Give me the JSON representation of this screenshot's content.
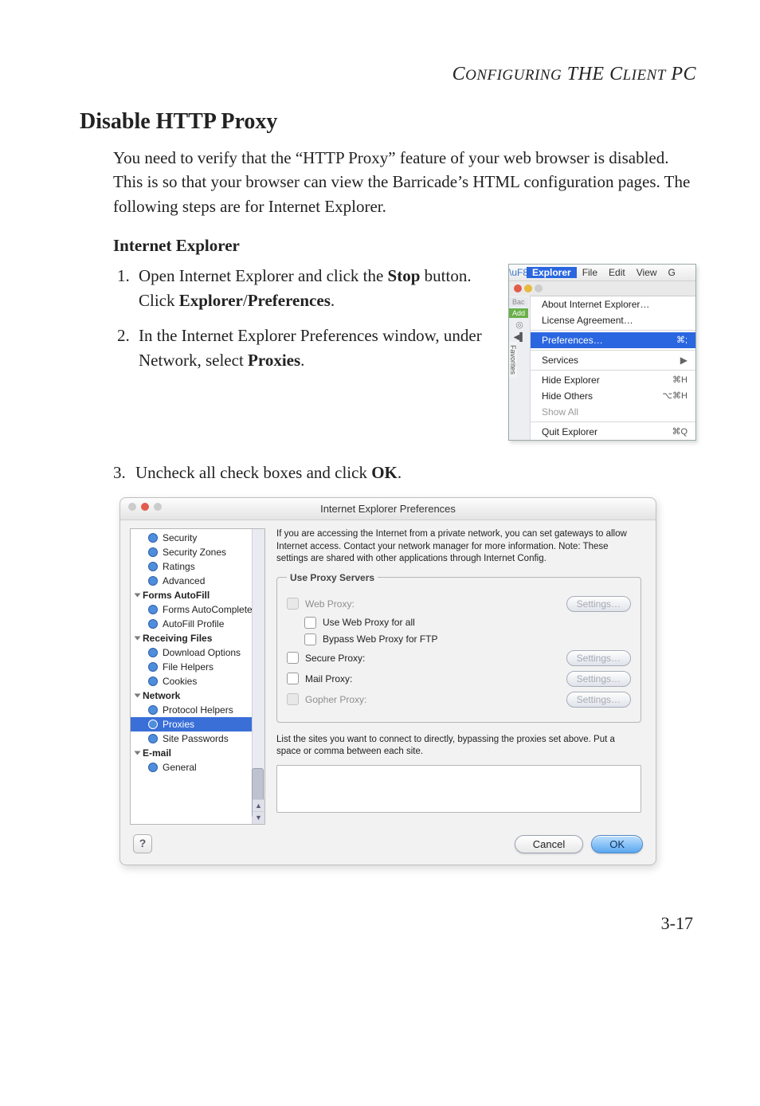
{
  "doc": {
    "running_head_1": "C",
    "running_head_2": "ONFIGURING",
    "running_head_3": " THE ",
    "running_head_4": "C",
    "running_head_5": "LIENT",
    "running_head_6": " PC",
    "page_number": "3-17",
    "title": "Disable HTTP Proxy",
    "intro": "You need to verify that the “HTTP Proxy” feature of your web browser is disabled. This is so that your browser can view the Barricade’s HTML configuration pages. The following steps are for Internet Explorer.",
    "subhead": "Internet Explorer",
    "step1_a": "Open Internet Explorer and click the ",
    "step1_b": "Stop",
    "step1_c": " button. Click ",
    "step1_d": "Explorer",
    "step1_e": "/",
    "step1_f": "Preferences",
    "step1_g": ".",
    "step2_a": "In the Internet Explorer Preferences window, under Network, select ",
    "step2_b": "Proxies",
    "step2_c": ".",
    "step3_a": "Uncheck all check boxes and click ",
    "step3_b": "OK",
    "step3_c": "."
  },
  "menu": {
    "bar": {
      "explorer": "Explorer",
      "file": "File",
      "edit": "Edit",
      "view": "View",
      "g": "G"
    },
    "back": "Bac",
    "add": "Add",
    "fav": "Favorites",
    "items": {
      "about": "About Internet Explorer…",
      "license": "License Agreement…",
      "prefs": "Preferences…",
      "prefs_sc": "⌘;",
      "services": "Services",
      "hide_exp": "Hide Explorer",
      "hide_exp_sc": "⌘H",
      "hide_oth": "Hide Others",
      "hide_oth_sc": "⌥⌘H",
      "show_all": "Show All",
      "quit": "Quit Explorer",
      "quit_sc": "⌘Q"
    }
  },
  "pref": {
    "title": "Internet Explorer Preferences",
    "desc": "If you are accessing the Internet from a private network, you can set gateways to allow Internet access.  Contact your network manager for more information.  Note: These settings are shared with other applications through Internet Config.",
    "legend": "Use Proxy Servers",
    "rows": {
      "web": "Web Proxy:",
      "use_web_all": "Use Web Proxy for all",
      "bypass_ftp": "Bypass Web Proxy for FTP",
      "secure": "Secure Proxy:",
      "mail": "Mail Proxy:",
      "gopher": "Gopher Proxy:",
      "settings": "Settings…"
    },
    "bypass_caption": "List the sites you want to connect to directly,  bypassing the proxies set above.  Put a space or comma between each site.",
    "footer": {
      "help": "?",
      "cancel": "Cancel",
      "ok": "OK"
    },
    "side": {
      "security": "Security",
      "security_zones": "Security Zones",
      "ratings": "Ratings",
      "advanced": "Advanced",
      "forms_autofill": "Forms AutoFill",
      "forms_autocomplete": "Forms AutoComplete",
      "autofill_profile": "AutoFill Profile",
      "receiving_files": "Receiving Files",
      "download_options": "Download Options",
      "file_helpers": "File Helpers",
      "cookies": "Cookies",
      "network": "Network",
      "protocol_helpers": "Protocol Helpers",
      "proxies": "Proxies",
      "site_passwords": "Site Passwords",
      "email": "E-mail",
      "general": "General"
    }
  }
}
